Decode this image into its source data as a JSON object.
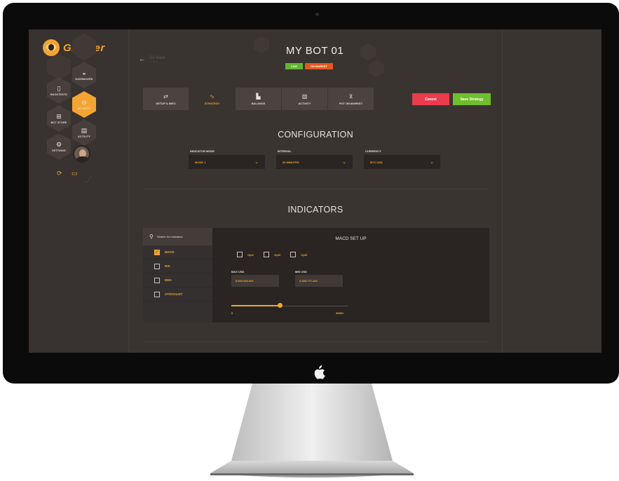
{
  "app": {
    "logo_text": "Gimmer"
  },
  "sidebar": {
    "items": [
      {
        "label": "DASHBOARD",
        "icon": "gauge-icon"
      },
      {
        "label": "BACKTESTS",
        "icon": "flask-icon"
      },
      {
        "label": "MY BOTS",
        "icon": "bot-icon",
        "active": true
      },
      {
        "label": "BOT STORE",
        "icon": "store-icon"
      },
      {
        "label": "ACTIVITY",
        "icon": "activity-icon"
      },
      {
        "label": "SETTINGS",
        "icon": "gear-icon"
      }
    ]
  },
  "header": {
    "go_back": "Go Back",
    "go_back_sub": "My Bots",
    "title": "MY BOT 01",
    "badges": {
      "live": "LIVE",
      "market": "ON MARKET"
    }
  },
  "tabs": [
    {
      "label": "SETUP & INFO",
      "icon": "sliders-icon"
    },
    {
      "label": "STRATEGY",
      "icon": "strategy-icon",
      "active": true
    },
    {
      "label": "BALANCE",
      "icon": "chart-icon"
    },
    {
      "label": "ACTIVITY",
      "icon": "clipboard-icon"
    },
    {
      "label": "PUT ON MARKET",
      "icon": "cart-icon"
    }
  ],
  "actions": {
    "cancel": "Cancel",
    "save": "Save Strategy"
  },
  "configuration": {
    "title": "CONFIGURATION",
    "indicator_mode": {
      "label": "INDICATOR MODE",
      "value": "MODE 1"
    },
    "interval": {
      "label": "INTERVAL",
      "value": "30 MINUTES"
    },
    "currency": {
      "label": "CURRENCY",
      "value": "BTC USD"
    }
  },
  "indicators": {
    "title": "INDICATORS",
    "search_placeholder": "Search for indicators",
    "list": [
      {
        "label": "MACD",
        "checked": true
      },
      {
        "label": "RSI",
        "checked": false
      },
      {
        "label": "EMA",
        "checked": false
      },
      {
        "label": "STOCKLIST",
        "checked": false
      }
    ],
    "setup": {
      "title": "MACD SET UP",
      "options": [
        "Opt1",
        "Opt2",
        "Opt3"
      ],
      "max_usd_label": "MAX USD",
      "max_usd_value": "5.000.000.000",
      "min_usd_label": "MIN USD",
      "min_usd_value": "2.335.777.133",
      "slider_min": "0",
      "slider_max": "36862",
      "slider_fraction": 0.42
    }
  },
  "colors": {
    "accent": "#f2a531",
    "live": "#5fb82e",
    "market": "#e4571f",
    "cancel": "#e93d4d",
    "save": "#6fbe2c"
  }
}
